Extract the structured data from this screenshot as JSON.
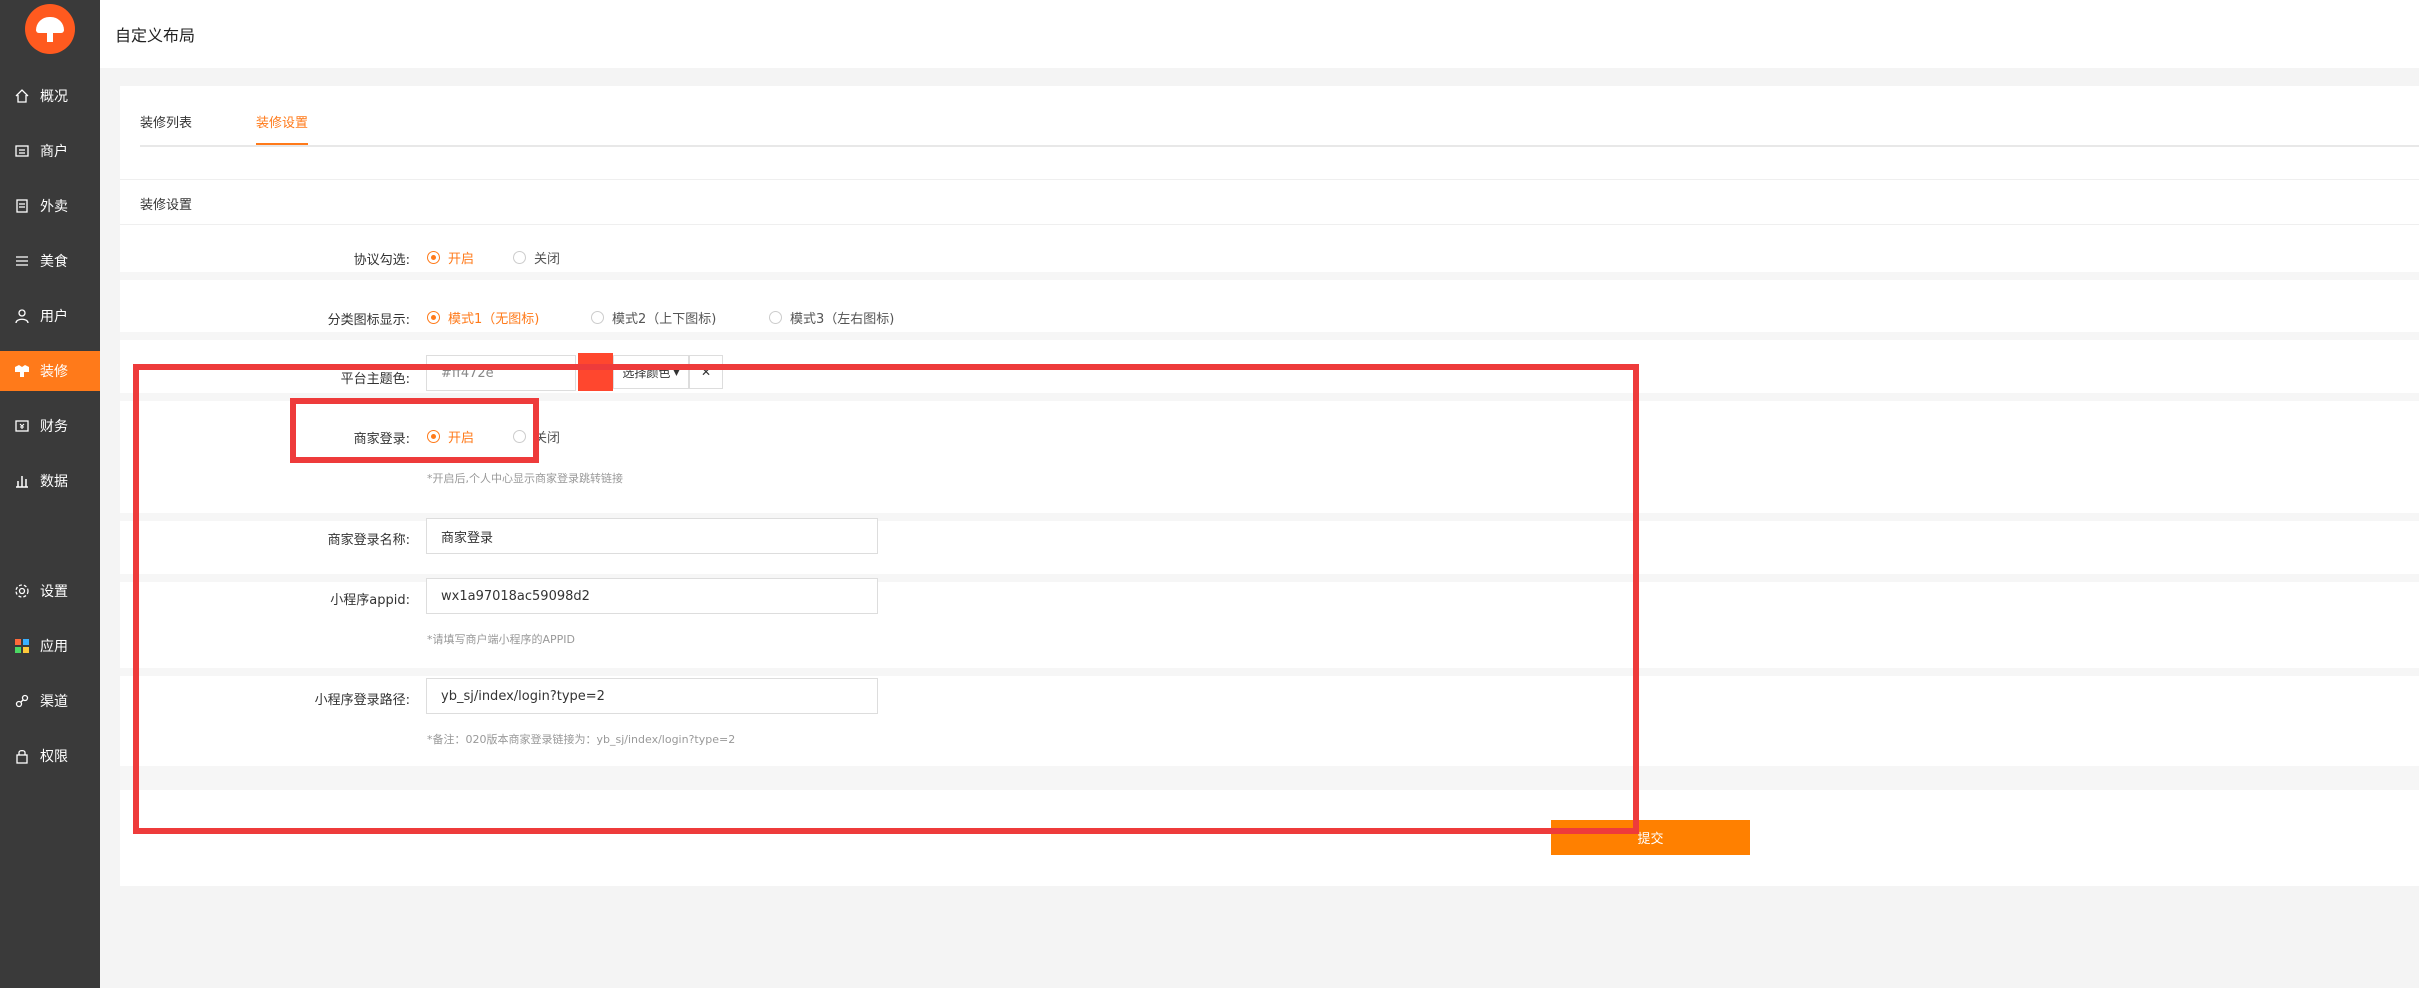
{
  "sidebar": {
    "items": [
      {
        "label": "概况",
        "icon": "home-icon"
      },
      {
        "label": "商户",
        "icon": "merchant-icon"
      },
      {
        "label": "外卖",
        "icon": "takeout-icon"
      },
      {
        "label": "美食",
        "icon": "menu-icon"
      },
      {
        "label": "用户",
        "icon": "user-icon"
      },
      {
        "label": "装修",
        "icon": "decoration-icon"
      },
      {
        "label": "财务",
        "icon": "finance-icon"
      },
      {
        "label": "数据",
        "icon": "chart-icon"
      },
      {
        "label": "设置",
        "icon": "gear-icon"
      },
      {
        "label": "应用",
        "icon": "apps-icon"
      },
      {
        "label": "渠道",
        "icon": "channel-icon"
      },
      {
        "label": "权限",
        "icon": "lock-icon"
      }
    ],
    "active": "装修"
  },
  "header": {
    "title": "自定义布局"
  },
  "tabs": [
    {
      "label": "装修列表",
      "active": false
    },
    {
      "label": "装修设置",
      "active": true
    }
  ],
  "section": {
    "title": "装修设置"
  },
  "form": {
    "agreement": {
      "label": "协议勾选:",
      "options": [
        "开启",
        "关闭"
      ],
      "selected": "开启"
    },
    "category_icon": {
      "label": "分类图标显示:",
      "options": [
        "模式1（无图标)",
        "模式2（上下图标)",
        "模式3（左右图标)"
      ],
      "selected": "模式1（无图标)"
    },
    "theme_color": {
      "label": "平台主题色:",
      "value": "#ff472e",
      "button": "选择颜色",
      "clear": "✕",
      "swatch": "#ff472e"
    },
    "merchant_login": {
      "label": "商家登录:",
      "options": [
        "开启",
        "关闭"
      ],
      "selected": "开启",
      "hint": "*开启后,个人中心显示商家登录跳转链接"
    },
    "merchant_login_name": {
      "label": "商家登录名称:",
      "value": "商家登录"
    },
    "miniapp_appid": {
      "label": "小程序appid:",
      "value": "wx1a97018ac59098d2",
      "hint": "*请填写商户端小程序的APPID"
    },
    "miniapp_login_path": {
      "label": "小程序登录路径:",
      "value": "yb_sj/index/login?type=2",
      "hint": "*备注：020版本商家登录链接为：yb_sj/index/login?type=2"
    }
  },
  "submit": {
    "label": "提交"
  },
  "colors": {
    "accent": "#ff7a1a",
    "sidebar_bg": "#3a3a3a",
    "annotation": "#ee3b3b"
  }
}
